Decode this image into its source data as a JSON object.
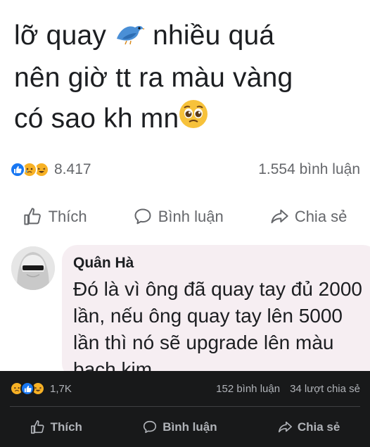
{
  "post": {
    "line1_a": "lỡ quay ",
    "line1_b": " nhiều quá",
    "line2": "nên giờ tt ra màu vàng",
    "line3": "có sao kh mn"
  },
  "stats": {
    "reaction_count": "8.417",
    "comment_count": "1.554 bình luận"
  },
  "actions": {
    "like": "Thích",
    "comment": "Bình luận",
    "share": "Chia sẻ"
  },
  "comment": {
    "author": "Quân Hà",
    "text": "Đó là vì ông đã quay tay đủ 2000 lần, nếu ông quay tay lên 5000 lần thì nó sẽ upgrade lên màu bạch kim"
  },
  "overlay": {
    "reaction_count": "1,7K",
    "comment_count": "152 bình luận",
    "share_count": "34 lượt chia sẻ",
    "like": "Thích",
    "comment": "Bình luận",
    "share": "Chia sẻ"
  }
}
